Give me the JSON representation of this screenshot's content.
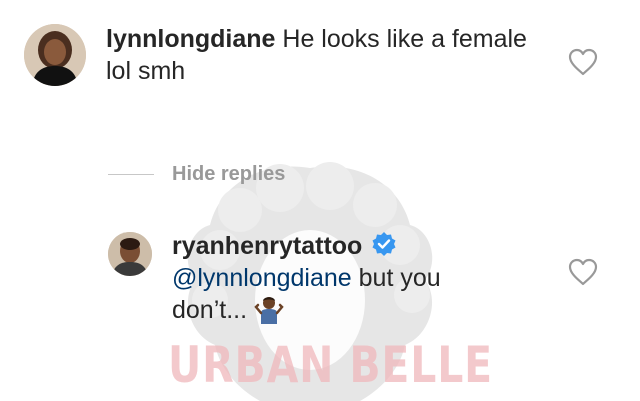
{
  "watermark": {
    "text": "URBAN BELLE",
    "color": "#f0b8bc"
  },
  "comment1": {
    "username": "lynnlongdiane",
    "text": "He looks like a female lol smh"
  },
  "replies": {
    "hide_label": "Hide replies"
  },
  "comment2": {
    "username": "ryanhenrytattoo",
    "mention": "@lynnlongdiane",
    "text": " but you don’t...",
    "emoji": "person-shrugging-emoji",
    "verified_icon": "verified-badge-icon"
  },
  "colors": {
    "text": "#262626",
    "mention": "#00376b",
    "muted": "#999999",
    "verified": "#3897f0"
  }
}
